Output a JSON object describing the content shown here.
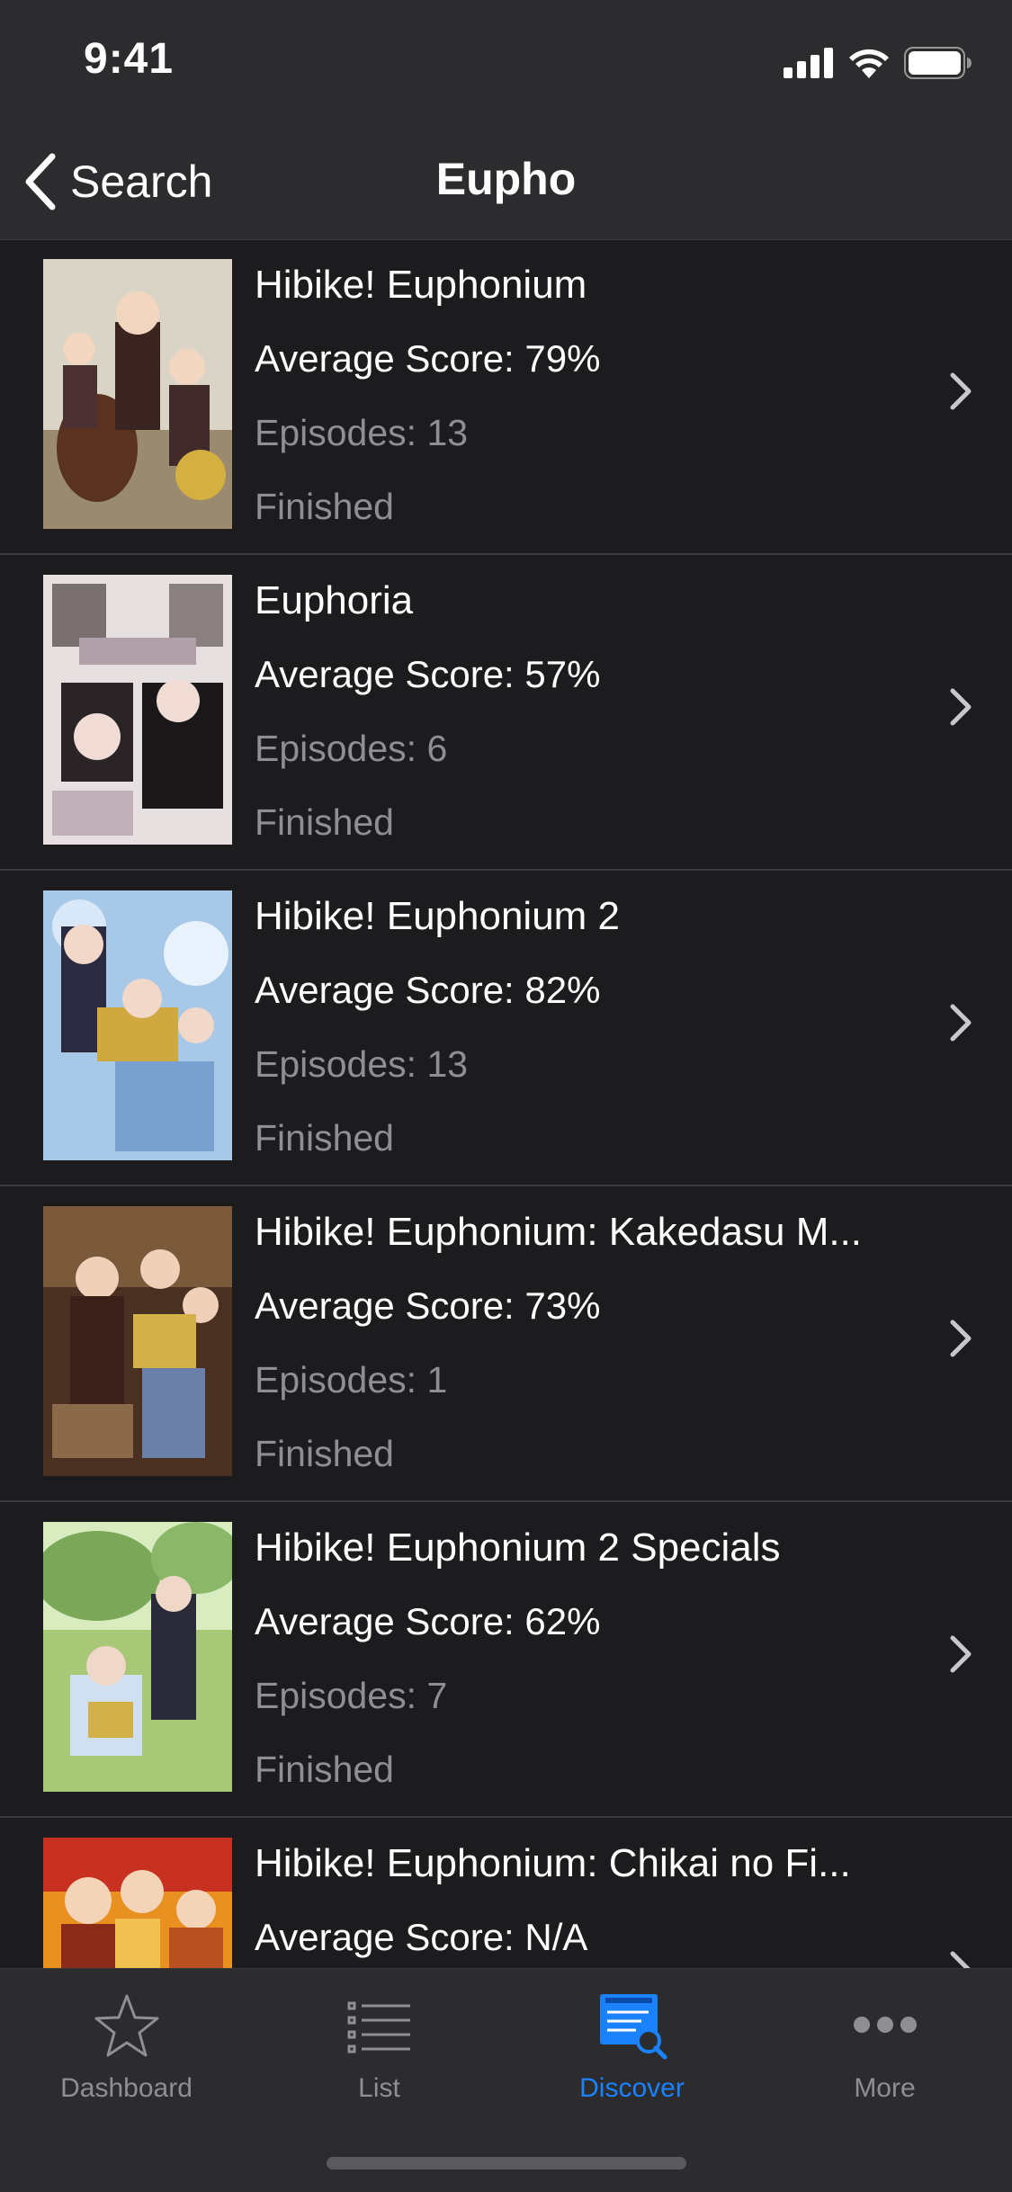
{
  "status_bar": {
    "time": "9:41"
  },
  "nav": {
    "back_label": "Search",
    "title": "Eupho"
  },
  "results": [
    {
      "title": "Hibike! Euphonium",
      "score": "Average Score: 79%",
      "episodes": "Episodes: 13",
      "status": "Finished"
    },
    {
      "title": "Euphoria",
      "score": "Average Score: 57%",
      "episodes": "Episodes: 6",
      "status": "Finished"
    },
    {
      "title": "Hibike! Euphonium 2",
      "score": "Average Score: 82%",
      "episodes": "Episodes: 13",
      "status": "Finished"
    },
    {
      "title": "Hibike! Euphonium: Kakedasu M...",
      "score": "Average Score: 73%",
      "episodes": "Episodes: 1",
      "status": "Finished"
    },
    {
      "title": "Hibike! Euphonium 2 Specials",
      "score": "Average Score: 62%",
      "episodes": "Episodes: 7",
      "status": "Finished"
    },
    {
      "title": "Hibike! Euphonium: Chikai no Fi...",
      "score": "Average Score: N/A",
      "episodes": "",
      "status": ""
    }
  ],
  "tabs": [
    {
      "label": "Dashboard",
      "icon": "star-icon"
    },
    {
      "label": "List",
      "icon": "list-icon"
    },
    {
      "label": "Discover",
      "icon": "discover-icon"
    },
    {
      "label": "More",
      "icon": "more-icon"
    }
  ],
  "colors": {
    "accent": "#1a82ff",
    "background": "#1c1c1e",
    "bar": "#2c2c2e",
    "secondary_text": "#8e8e93"
  }
}
